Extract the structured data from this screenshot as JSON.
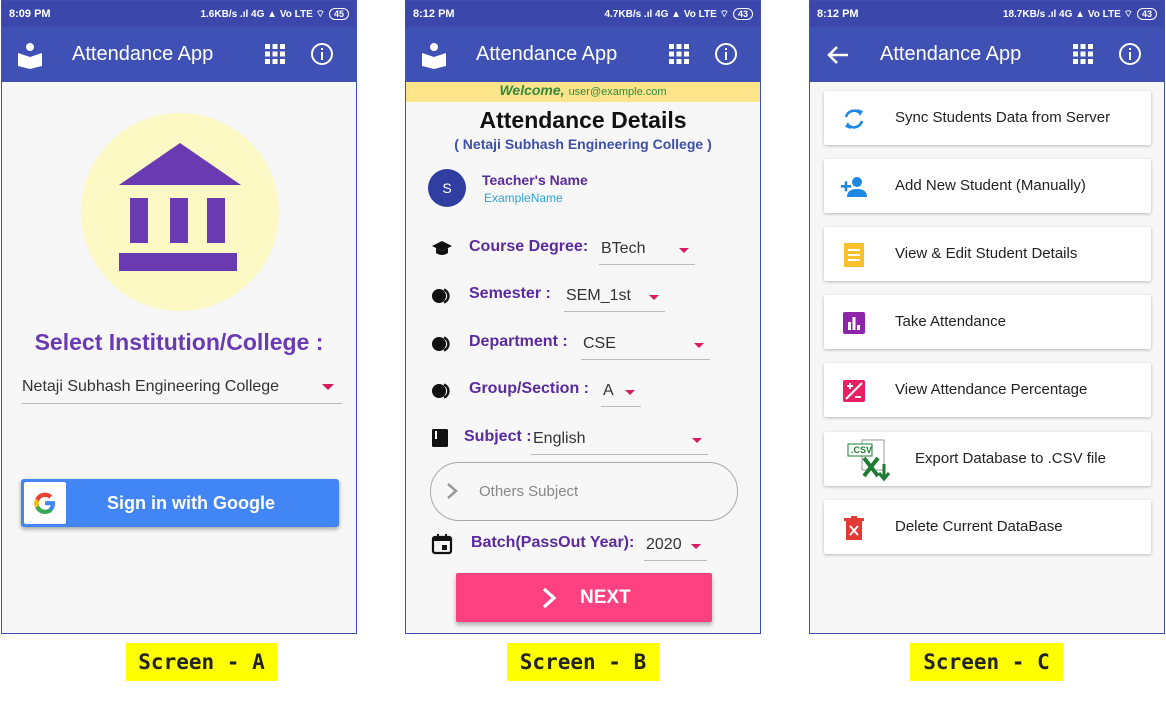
{
  "screens": [
    {
      "status": {
        "time": "8:09 PM",
        "net": "1.6KB/s .ıl 4G ▲ Vo LTE ⌔",
        "battery": "45"
      },
      "appbar": {
        "title": "Attendance App"
      },
      "select_title": "Select Institution/College :",
      "college_value": "Netaji Subhash Engineering College",
      "signin_label": "Sign in with Google",
      "caption": "Screen - A"
    },
    {
      "status": {
        "time": "8:12 PM",
        "net": "4.7KB/s .ıl 4G ▲ Vo LTE ⌔",
        "battery": "43"
      },
      "appbar": {
        "title": "Attendance App"
      },
      "welcome": "Welcome,",
      "email": "user@example.com",
      "title": "Attendance Details",
      "college": "( Netaji Subhash Engineering College )",
      "avatar_letter": "S",
      "teacher_label": "Teacher's Name",
      "teacher_value": "ExampleName",
      "fields": [
        {
          "label": "Course Degree:",
          "value": "BTech"
        },
        {
          "label": "Semester :",
          "value": "SEM_1st"
        },
        {
          "label": "Department :",
          "value": "CSE"
        },
        {
          "label": "Group/Section :",
          "value": "A"
        },
        {
          "label": "Subject :",
          "value": "English"
        },
        {
          "label": "Batch(PassOut Year):",
          "value": "2020"
        }
      ],
      "others_placeholder": "Others Subject",
      "next_label": "NEXT",
      "caption": "Screen - B"
    },
    {
      "status": {
        "time": "8:12 PM",
        "net": "18.7KB/s .ıl 4G ▲ Vo LTE ⌔",
        "battery": "43"
      },
      "appbar": {
        "title": "Attendance App"
      },
      "menu": [
        {
          "label": "Sync Students Data from Server",
          "icon": "sync-icon",
          "color": "#1e88e5"
        },
        {
          "label": "Add New Student (Manually)",
          "icon": "add-person-icon",
          "color": "#1e88e5"
        },
        {
          "label": "View & Edit Student Details",
          "icon": "notes-icon",
          "color": "#fbc02d"
        },
        {
          "label": "Take Attendance",
          "icon": "bar-chart-icon",
          "color": "#8e24aa"
        },
        {
          "label": "View Attendance Percentage",
          "icon": "percentage-icon",
          "color": "#e91e63"
        },
        {
          "label": "Export Database to .CSV file",
          "icon": "csv-excel-icon",
          "color": "#1e7b34"
        },
        {
          "label": "Delete Current DataBase",
          "icon": "trash-icon",
          "color": "#e53935"
        }
      ],
      "caption": "Screen - C"
    }
  ]
}
